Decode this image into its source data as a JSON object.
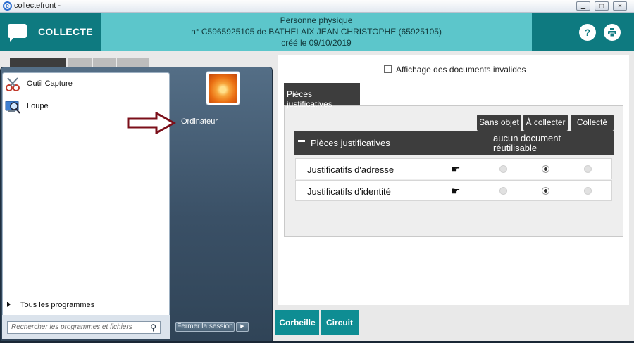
{
  "window": {
    "title": "collectefront -"
  },
  "header": {
    "app_name": "COLLECTE",
    "line1": "Personne physique",
    "line2": "n° C5965925105 de BATHELAIX JEAN CHRISTOPHE (65925105)",
    "line3": "créé le 09/10/2019",
    "help_label": "?",
    "print_icon": "printer-icon"
  },
  "content": {
    "invalid_docs_label": "Affichage des documents invalides",
    "tab_label": "Pièces justificatives",
    "column_buttons": [
      "Sans objet",
      "À collecter",
      "Collecté"
    ],
    "section_title": "Pièces justificatives",
    "reuse_label_1": "aucun document",
    "reuse_label_2": "réutilisable",
    "rows": [
      {
        "label": "Justificatifs d'adresse",
        "selected": "À collecter"
      },
      {
        "label": "Justificatifs d'identité",
        "selected": "À collecter"
      }
    ]
  },
  "bottom_buttons": {
    "corbeille": "Corbeille",
    "circuit": "Circuit"
  },
  "start_menu": {
    "programs": [
      {
        "label": "Outil Capture",
        "icon": "snipping-tool-icon"
      },
      {
        "label": "Loupe",
        "icon": "magnifier-icon"
      }
    ],
    "all_programs": "Tous les programmes",
    "search_placeholder": "Rechercher les programmes et fichiers",
    "right_items": {
      "computer": "Ordinateur"
    },
    "shutdown": "Fermer la session"
  },
  "colors": {
    "header_dark": "#0e7a80",
    "header_light": "#5cc6cb",
    "panel_dark": "#3d3d3d",
    "arrow": "#7b0f1a"
  }
}
